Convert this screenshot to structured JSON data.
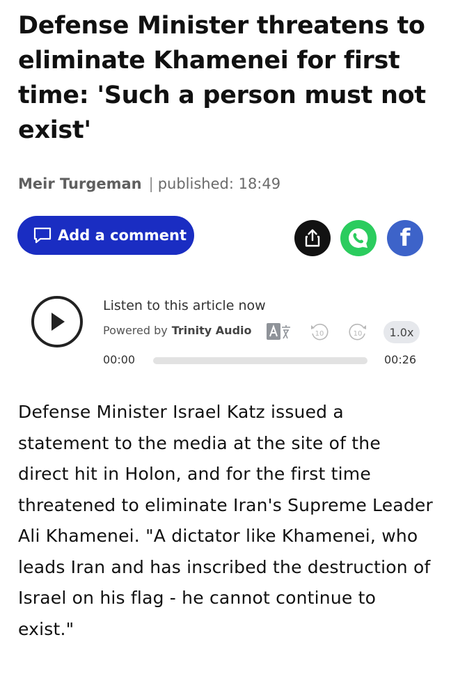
{
  "article": {
    "headline": "Defense Minister threatens to eliminate Khamenei for first time: 'Such a person must not exist'",
    "author": "Meir Turgeman",
    "separator": "|",
    "published_label": "published: 18:49",
    "body": "Defense Minister Israel Katz issued a statement to the media at the site of the direct hit in Holon, and for the first time threatened to eliminate Iran's Supreme Leader Ali Khamenei. \"A dictator like Khamenei, who leads Iran and has inscribed the destruction of Israel on his flag - he cannot continue to exist.\""
  },
  "actions": {
    "comment_label": "Add a comment",
    "comment_icon": "comment-icon",
    "share_icon": "share-icon",
    "whatsapp_icon": "whatsapp-icon",
    "facebook_icon": "facebook-icon",
    "facebook_glyph": "f"
  },
  "audio": {
    "listen_label": "Listen to this article now",
    "powered_prefix": "Powered by",
    "powered_brand": "Trinity Audio",
    "skip_back_label": "10",
    "skip_forward_label": "10",
    "speed": "1.0x",
    "current_time": "00:00",
    "duration": "00:26",
    "progress": 0
  },
  "colors": {
    "primary": "#1a2dc2",
    "whatsapp": "#2bcc5e",
    "facebook": "#3d63c9",
    "share": "#121212"
  }
}
